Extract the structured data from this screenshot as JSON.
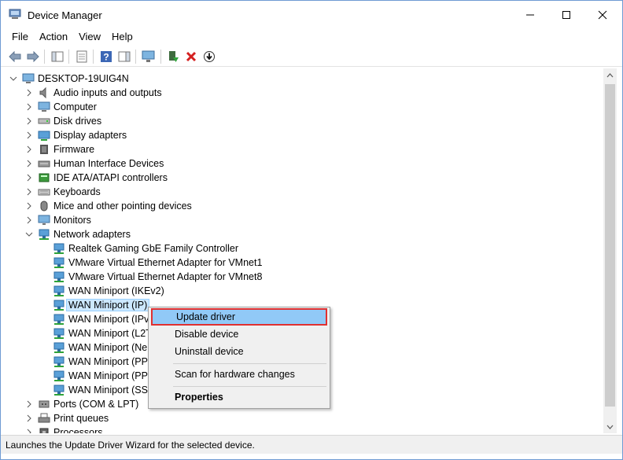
{
  "window": {
    "title": "Device Manager"
  },
  "menu": [
    "File",
    "Action",
    "View",
    "Help"
  ],
  "toolbar": {
    "icons": [
      "back-arrow-icon",
      "forward-arrow-icon",
      "show-hide-console-tree-icon",
      "properties-icon",
      "help-icon",
      "action-pane-icon",
      "scan-hardware-icon",
      "update-driver-icon",
      "uninstall-icon",
      "download-icon"
    ]
  },
  "tree": {
    "root": "DESKTOP-19UIG4N",
    "categories": [
      {
        "label": "Audio inputs and outputs",
        "icon": "speaker-icon"
      },
      {
        "label": "Computer",
        "icon": "computer-icon"
      },
      {
        "label": "Disk drives",
        "icon": "disk-drive-icon"
      },
      {
        "label": "Display adapters",
        "icon": "display-adapter-icon"
      },
      {
        "label": "Firmware",
        "icon": "firmware-icon"
      },
      {
        "label": "Human Interface Devices",
        "icon": "hid-icon"
      },
      {
        "label": "IDE ATA/ATAPI controllers",
        "icon": "ide-controller-icon"
      },
      {
        "label": "Keyboards",
        "icon": "keyboard-icon"
      },
      {
        "label": "Mice and other pointing devices",
        "icon": "mouse-icon"
      },
      {
        "label": "Monitors",
        "icon": "monitor-icon"
      }
    ],
    "network": {
      "label": "Network adapters",
      "children": [
        "Realtek Gaming GbE Family Controller",
        "VMware Virtual Ethernet Adapter for VMnet1",
        "VMware Virtual Ethernet Adapter for VMnet8",
        "WAN Miniport (IKEv2)",
        "WAN Miniport (IP)",
        "WAN Miniport (IPv",
        "WAN Miniport (L2T",
        "WAN Miniport (Ne",
        "WAN Miniport (PP",
        "WAN Miniport (PP",
        "WAN Miniport (SST"
      ],
      "selected_index": 4
    },
    "after": [
      {
        "label": "Ports (COM & LPT)",
        "icon": "port-icon"
      },
      {
        "label": "Print queues",
        "icon": "printer-icon"
      },
      {
        "label": "Processors",
        "icon": "processor-icon"
      }
    ]
  },
  "context_menu": {
    "items": [
      "Update driver",
      "Disable device",
      "Uninstall device",
      "Scan for hardware changes",
      "Properties"
    ]
  },
  "status": "Launches the Update Driver Wizard for the selected device.",
  "colors": {
    "selection": "#cce8ff",
    "menu_highlight": "#91c9f7",
    "highlight_border": "#e03030"
  }
}
